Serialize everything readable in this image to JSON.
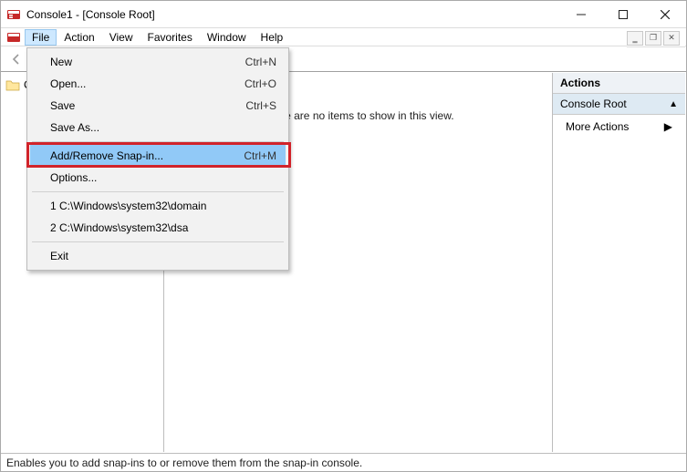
{
  "window": {
    "title": "Console1 - [Console Root]"
  },
  "menubar": {
    "items": [
      "File",
      "Action",
      "View",
      "Favorites",
      "Window",
      "Help"
    ]
  },
  "tree": {
    "root_label": "Console Root"
  },
  "content": {
    "empty_text": "There are no items to show in this view."
  },
  "actions": {
    "header": "Actions",
    "group": "Console Root",
    "more": "More Actions"
  },
  "statusbar": {
    "text": "Enables you to add snap-ins to or remove them from the snap-in console."
  },
  "file_menu": {
    "new": {
      "label": "New",
      "shortcut": "Ctrl+N"
    },
    "open": {
      "label": "Open...",
      "shortcut": "Ctrl+O"
    },
    "save": {
      "label": "Save",
      "shortcut": "Ctrl+S"
    },
    "save_as": {
      "label": "Save As..."
    },
    "add_remove": {
      "label": "Add/Remove Snap-in...",
      "shortcut": "Ctrl+M"
    },
    "options": {
      "label": "Options..."
    },
    "recent1": {
      "label": "1 C:\\Windows\\system32\\domain"
    },
    "recent2": {
      "label": "2 C:\\Windows\\system32\\dsa"
    },
    "exit": {
      "label": "Exit"
    }
  }
}
